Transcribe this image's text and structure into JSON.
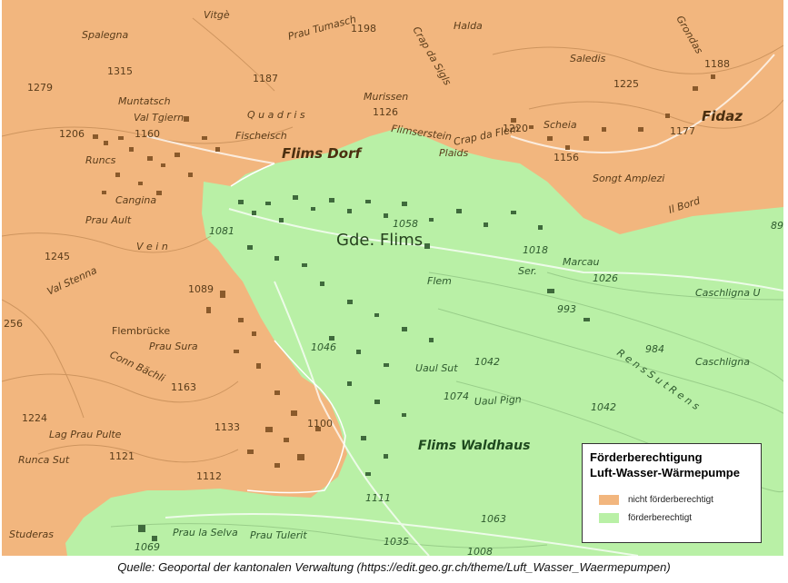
{
  "colors": {
    "nicht_foerderberechtigt": "#f2b67e",
    "foerderberechtigt": "#b9f0a6",
    "building_orange": "#8a5a2b",
    "building_green": "#3f6a3c"
  },
  "legend": {
    "title_line1": "Förderberechtigung",
    "title_line2": "Luft-Wasser-Wärmepumpe",
    "items": [
      {
        "label": "nicht förderberechtigt",
        "color": "#f2b67e"
      },
      {
        "label": "förderberechtigt",
        "color": "#b9f0a6"
      }
    ]
  },
  "caption": "Quelle: Geoportal der kantonalen Verwaltung (https://edit.geo.gr.ch/theme/Luft_Wasser_Waermepumpen)",
  "map_labels": {
    "spalegna": "Spalegna",
    "vitge": "Vitgè",
    "prau_tumasch": "Prau Tumasch",
    "n1198": "1198",
    "halda": "Halda",
    "crap_da_sigls": "Crap da Sigls",
    "grondas": "Grondas",
    "n1315": "1315",
    "n1279": "1279",
    "n1187": "1187",
    "saledis": "Saledis",
    "n1188": "1188",
    "n1225": "1225",
    "muntatsch": "Muntatsch",
    "val_tgiern": "Val Tgiern",
    "murissen": "Murissen",
    "quadris": "Q u a d r i s",
    "n1126": "1126",
    "fidaz": "Fidaz",
    "scheia": "Scheia",
    "n1206": "1206",
    "n1160": "1160",
    "fischeisch": "Fischeisch",
    "flimserstein": "Flimserstein",
    "crap_da_flem": "Crap da Flem",
    "n1220": "1220",
    "n1177": "1177",
    "flims_dorf": "Flims Dorf",
    "plaids": "Plaids",
    "runcs": "Runcs",
    "n1156": "1156",
    "songt_amplezi": "Songt Amplezi",
    "cangina": "Cangina",
    "il_bord": "Il Bord",
    "prau_ault": "Prau Ault",
    "n1058": "1058",
    "n1081": "1081",
    "gde_flims": "Gde. Flims",
    "vein": "V e i n",
    "n1245": "1245",
    "n1018": "1018",
    "marcau": "Marcau",
    "n89": "89",
    "flem": "Flem",
    "ser": "Ser.",
    "n1026": "1026",
    "caschligna_u": "Caschligna U",
    "val_stenna": "Val Stenna",
    "n1089": "1089",
    "n993": "993",
    "n256": "256",
    "flembruecke": "Flembrücke",
    "prau_sura": "Prau Sura",
    "n1046": "1046",
    "n984": "984",
    "caschligna": "Caschligna",
    "conn_bachli": "Conn Bächli",
    "uaul_sut": "Uaul Sut",
    "n1042a": "1042",
    "n1163": "1163",
    "n1074": "1074",
    "uaul_pign": "Uaul Pign",
    "n1042b": "1042",
    "rens_sut_rens": "R e n s   S u t   R e n s",
    "n1224": "1224",
    "n1100": "1100",
    "lag_prau_pulte": "Lag Prau Pulte",
    "n1133": "1133",
    "flims_waldhaus": "Flims Waldhaus",
    "runca_sut": "Runca Sut",
    "n1121": "1121",
    "n1112": "1112",
    "n1111": "1111",
    "n1063": "1063",
    "prau_la_selva": "Prau la Selva",
    "prau_tulerit": "Prau Tulerit",
    "studeras": "Studeras",
    "n1069": "1069",
    "n1035": "1035",
    "n1008": "1008"
  }
}
